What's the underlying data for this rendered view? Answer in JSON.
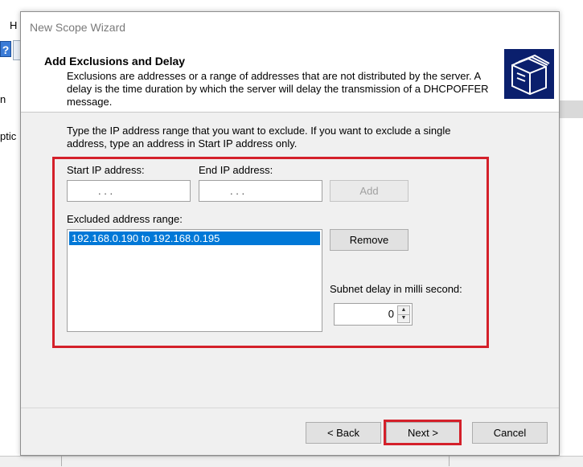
{
  "background": {
    "menu_letter": "H",
    "help_icon_text": "?",
    "partial_text_n": "n",
    "partial_text_optic": "ptic"
  },
  "dialog": {
    "title": "New Scope Wizard",
    "header_title": "Add Exclusions and Delay",
    "header_description": "Exclusions are addresses or a range of addresses that are not distributed by the server. A delay is the time duration by which the server will delay the transmission of a DHCPOFFER message.",
    "instructions": "Type the IP address range that you want to exclude. If you want to exclude a single address, type an address in Start IP address only.",
    "start_ip_label": "Start IP address:",
    "end_ip_label": "End IP address:",
    "start_ip_placeholder": ".     .     .",
    "end_ip_placeholder": ".     .     .",
    "add_button": "Add",
    "excluded_range_label": "Excluded address range:",
    "excluded_ranges": [
      "192.168.0.190 to 192.168.0.195"
    ],
    "remove_button": "Remove",
    "subnet_delay_label": "Subnet delay in milli second:",
    "subnet_delay_value": "0",
    "back_button": "< Back",
    "next_button": "Next >",
    "cancel_button": "Cancel"
  },
  "colors": {
    "highlight_red": "#d4202a",
    "selection_blue": "#0078d7",
    "icon_navy": "#0a1f6d"
  }
}
